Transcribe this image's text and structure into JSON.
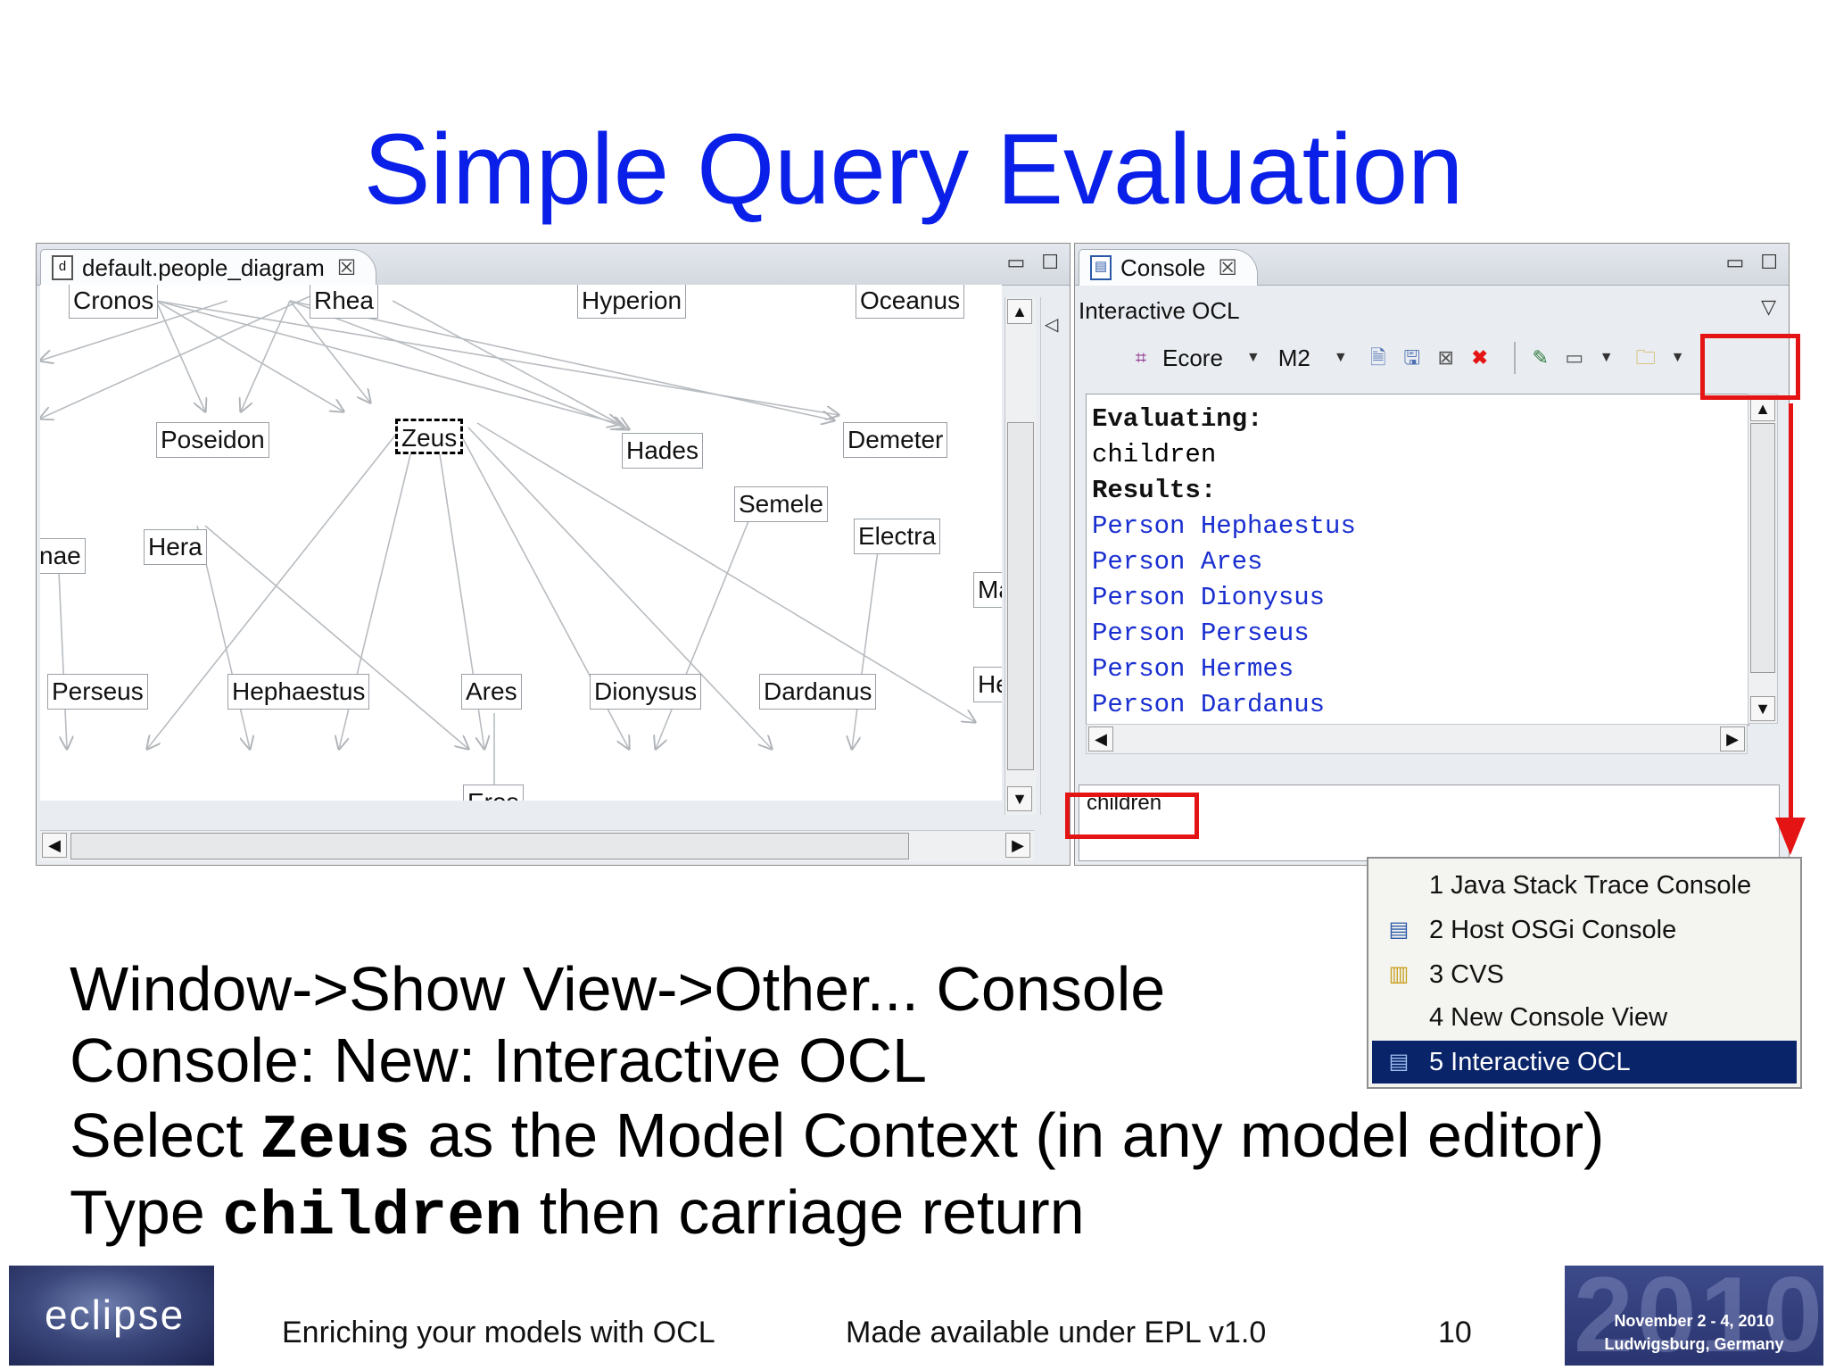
{
  "slide": {
    "title": "Simple Query Evaluation",
    "lines": [
      {
        "pre": "Window->Show View->Other... Console",
        "code": "",
        "post": ""
      },
      {
        "pre": "Console: New: Interactive OCL",
        "code": "",
        "post": ""
      },
      {
        "pre": "Select ",
        "code": "Zeus",
        "post": " as the Model Context (in any model editor)"
      },
      {
        "pre": "Type ",
        "code": "children",
        "post": " then carriage return"
      }
    ],
    "footer": {
      "logo_text": "eclipse",
      "course": "Enriching your models with OCL",
      "license": "Made available under EPL v1.0",
      "page": "10",
      "conf_year": "2010",
      "conf_date": "November 2 - 4, 2010",
      "conf_place": "Ludwigsburg, Germany"
    }
  },
  "diagram_editor": {
    "tab_label": "default.people_diagram",
    "tab_icon": "diagram-file-icon",
    "nodes": [
      "Cronos",
      "Rhea",
      "Hyperion",
      "Oceanus",
      "Poseidon",
      "Zeus",
      "Hades",
      "Demeter",
      "Semele",
      "Electra",
      "nae",
      "Hera",
      "Ma",
      "He",
      "Perseus",
      "Hephaestus",
      "Ares",
      "Dionysus",
      "Dardanus",
      "Eros"
    ],
    "selected": "Zeus"
  },
  "console": {
    "tab_label": "Console",
    "tab_icon": "console-icon",
    "subtitle": "Interactive OCL",
    "toolbar": {
      "metamodel": "Ecore",
      "level": "M2"
    },
    "output": {
      "evaluating_label": "Evaluating:",
      "expression": "children",
      "results_label": "Results:",
      "results": [
        "Person Hephaestus",
        "Person Ares",
        "Person Dionysus",
        "Person Perseus",
        "Person Hermes",
        "Person Dardanus"
      ]
    },
    "input_value": "children"
  },
  "console_menu": {
    "items": [
      {
        "label": "1 Java Stack Trace Console",
        "icon": ""
      },
      {
        "label": "2 Host OSGi Console",
        "icon": "osgi-console-icon"
      },
      {
        "label": "3 CVS",
        "icon": "cvs-console-icon"
      },
      {
        "label": "4 New Console View",
        "icon": ""
      },
      {
        "label": "5 Interactive OCL",
        "icon": "ocl-console-icon"
      }
    ],
    "active_index": 4
  },
  "colors": {
    "title": "#0a1fe8",
    "highlight": "#e51414",
    "result_text": "#1a2fd0",
    "menu_selection": "#0a246a"
  }
}
